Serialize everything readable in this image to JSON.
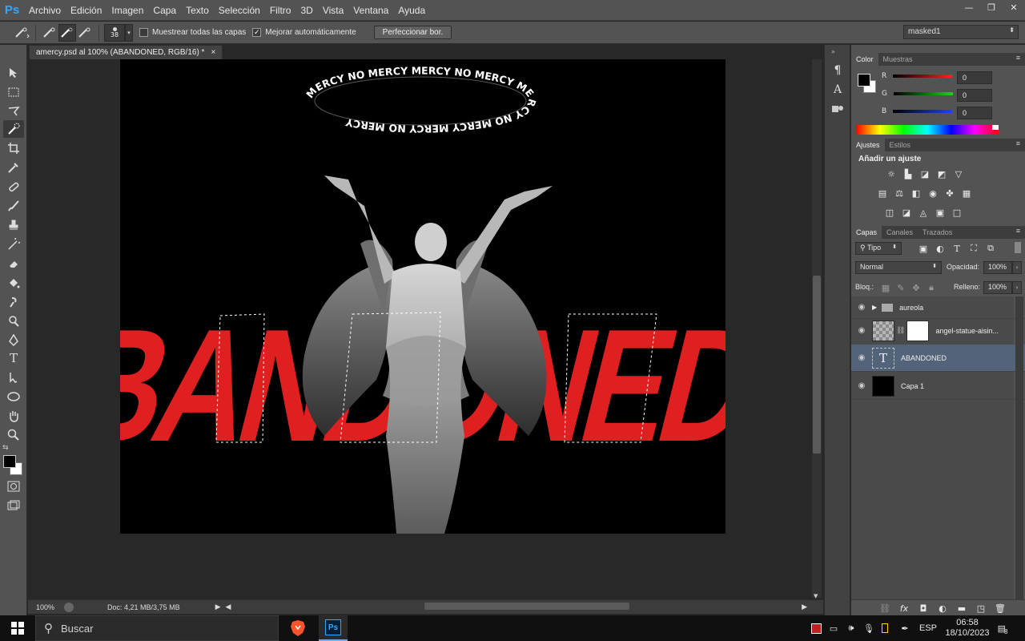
{
  "app": {
    "logo": "Ps"
  },
  "menu": [
    "Archivo",
    "Edición",
    "Imagen",
    "Capa",
    "Texto",
    "Selección",
    "Filtro",
    "3D",
    "Vista",
    "Ventana",
    "Ayuda"
  ],
  "window_controls": {
    "minimize": "—",
    "maximize": "❐",
    "close": "✕"
  },
  "options": {
    "brush_size": "38",
    "sample_all_label": "Muestrear todas las capas",
    "sample_all_checked": false,
    "auto_enhance_label": "Mejorar automáticamente",
    "auto_enhance_checked": true,
    "refine_label": "Perfeccionar bor.",
    "preset": "masked1"
  },
  "document": {
    "tab_title": "amercy.psd al 100% (ABANDONED, RGB/16) *",
    "tab_close": "×",
    "halo_text": "MERCY NO MERCY MERCY NO MERCY MERCY NO MERCY MERCY NO MERCY",
    "headline": "ABANDONED",
    "headline_color": "#e02020",
    "zoom": "100%",
    "doc_size": "Doc: 4,21 MB/3,75 MB"
  },
  "color_panel": {
    "tabs": [
      "Color",
      "Muestras"
    ],
    "channels": [
      {
        "label": "R",
        "value": "0",
        "color": "#ff2020"
      },
      {
        "label": "G",
        "value": "0",
        "color": "#20d020"
      },
      {
        "label": "B",
        "value": "0",
        "color": "#2040ff"
      }
    ]
  },
  "adjustments_panel": {
    "tabs": [
      "Ajustes",
      "Estilos"
    ],
    "heading": "Añadir un ajuste"
  },
  "layers_panel": {
    "tabs": [
      "Capas",
      "Canales",
      "Trazados"
    ],
    "filter": "Tipo",
    "blend_mode": "Normal",
    "opacity_label": "Opacidad:",
    "opacity": "100%",
    "lock_label": "Bloq.:",
    "fill_label": "Relleno:",
    "fill": "100%",
    "layers": [
      {
        "name": "aureola",
        "type": "group",
        "active": false
      },
      {
        "name": "angel-statue-aisin...",
        "type": "smart-mask",
        "active": false
      },
      {
        "name": "ABANDONED",
        "type": "text",
        "active": true
      },
      {
        "name": "Capa 1",
        "type": "fill",
        "active": false
      }
    ]
  },
  "taskbar": {
    "search_placeholder": "Buscar",
    "language": "ESP",
    "time": "06:58",
    "date": "18/10/2023",
    "notifications": "8"
  }
}
